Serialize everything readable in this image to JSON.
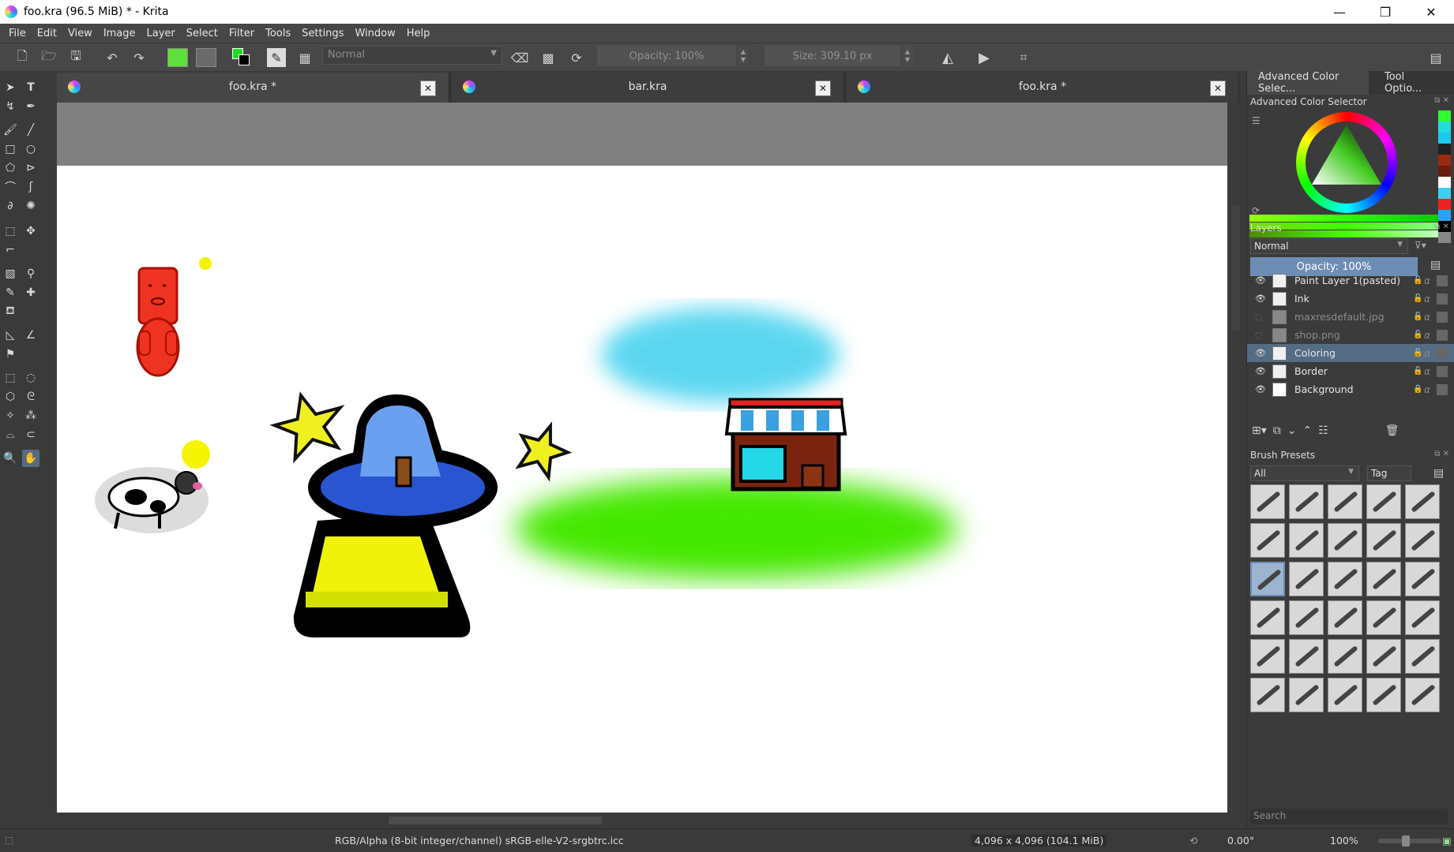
{
  "window": {
    "title": "foo.kra (96.5 MiB)  * - Krita",
    "minimize": "—",
    "restore": "❐",
    "close": "✕"
  },
  "menu": [
    "File",
    "Edit",
    "View",
    "Image",
    "Layer",
    "Select",
    "Filter",
    "Tools",
    "Settings",
    "Window",
    "Help"
  ],
  "tool_options": {
    "blend_mode": "Normal",
    "opacity": "Opacity: 100%",
    "size": "Size: 309.10 px",
    "fg_color": "#5fe03a",
    "bg_color": "#5a5a5a"
  },
  "doc_tabs": [
    {
      "label": "foo.kra *",
      "close": "✕",
      "active": true
    },
    {
      "label": "bar.kra",
      "close": "✕",
      "active": false
    },
    {
      "label": "foo.kra *",
      "close": "✕",
      "active": false
    }
  ],
  "dock": {
    "tabs": [
      "Advanced Color Selec...",
      "Tool Optio..."
    ],
    "color_selector_title": "Advanced Color Selector",
    "layers_title": "Layers",
    "layers_blend": "Normal",
    "layers_opacity": "Opacity:  100%",
    "layers": [
      {
        "name": "Paint Layer 1(pasted)",
        "visible": true,
        "selected": false
      },
      {
        "name": "Ink",
        "visible": true,
        "selected": false
      },
      {
        "name": "maxresdefault.jpg",
        "visible": false,
        "selected": false
      },
      {
        "name": "shop.png",
        "visible": false,
        "selected": false
      },
      {
        "name": "Coloring",
        "visible": true,
        "selected": true
      },
      {
        "name": "Border",
        "visible": true,
        "selected": false
      },
      {
        "name": "Background",
        "visible": true,
        "selected": false
      }
    ],
    "brush_presets_title": "Brush Presets",
    "brush_filter": "All",
    "tag_label": "Tag",
    "search_placeholder": "Search"
  },
  "status": {
    "color_space": "RGB/Alpha (8-bit integer/channel)  sRGB-elle-V2-srgbtrc.icc",
    "dimensions": "4,096 x 4,096 (104.1 MiB)",
    "rotation": "0.00°",
    "zoom": "100%"
  }
}
